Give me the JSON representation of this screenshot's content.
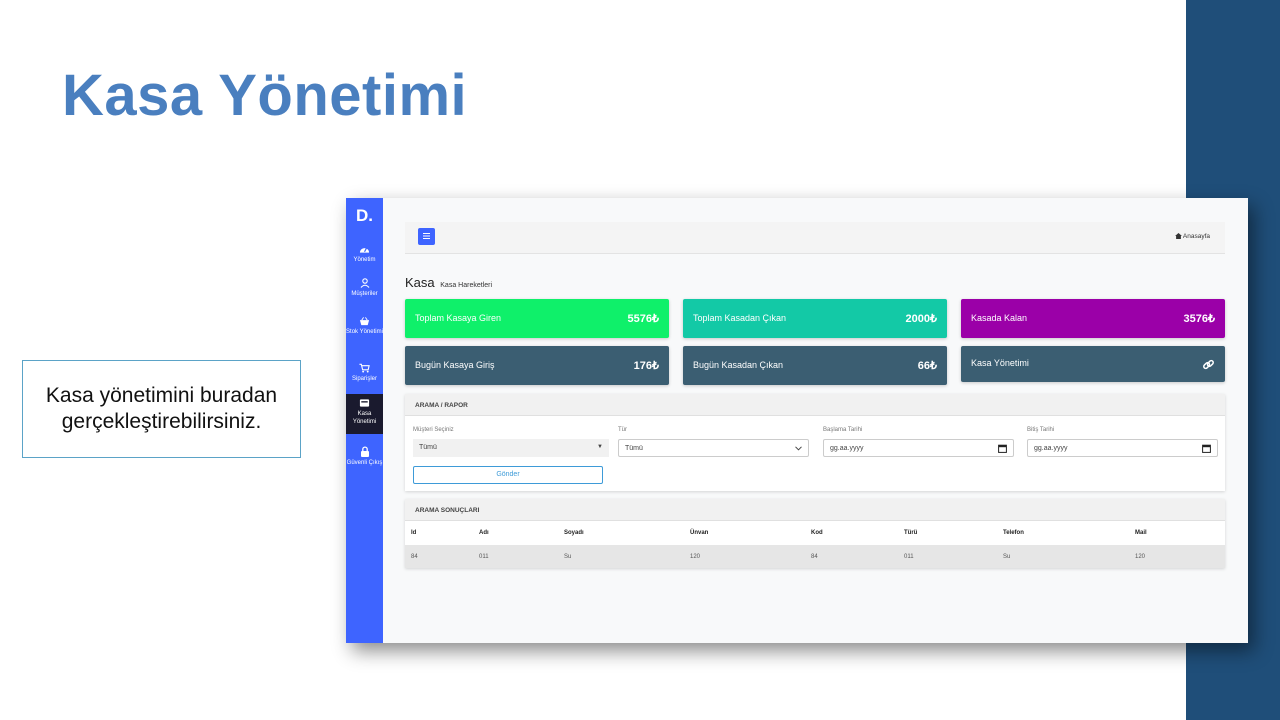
{
  "slide": {
    "title": "Kasa Yönetimi",
    "callout": "Kasa yönetimini buradan gerçekleştirebilirsiniz."
  },
  "colors": {
    "title": "#4a7fbf",
    "band": "#1f4e79",
    "sidebar": "#3e64ff",
    "green": "#0ff06a",
    "teal": "#13c9a6",
    "purple": "#9b00a8",
    "slate": "#3b5e72"
  },
  "app": {
    "logo": "D.",
    "nav": [
      {
        "label": "Yönetim",
        "icon": "dashboard-icon"
      },
      {
        "label": "Müşteriler",
        "icon": "user-icon"
      },
      {
        "label": "Stok Yönetimi",
        "icon": "basket-icon"
      },
      {
        "label": "Siparişler",
        "icon": "cart-icon"
      },
      {
        "label": "Kasa Yönetimi",
        "icon": "cash-register-icon"
      },
      {
        "label": "Güvenli Çıkış",
        "icon": "lock-icon"
      }
    ],
    "breadcrumb": "Anasayfa",
    "page_title": "Kasa",
    "page_subtitle": "Kasa Hareketleri",
    "cards": [
      {
        "label": "Toplam Kasaya Giren",
        "value": "5576₺"
      },
      {
        "label": "Toplam Kasadan Çıkan",
        "value": "2000₺"
      },
      {
        "label": "Kasada Kalan",
        "value": "3576₺"
      },
      {
        "label": "Bugün Kasaya Giriş",
        "value": "176₺"
      },
      {
        "label": "Bugün Kasadan Çıkan",
        "value": "66₺"
      },
      {
        "label": "Kasa Yönetimi",
        "icon": "link-icon"
      }
    ],
    "search": {
      "title": "ARAMA / RAPOR",
      "customer_label": "Müşteri Seçiniz",
      "customer_value": "Tümü",
      "type_label": "Tür",
      "type_value": "Tümü",
      "start_label": "Başlama Tarihi",
      "start_placeholder": "gg.aa.yyyy",
      "end_label": "Bitiş Tarihi",
      "end_placeholder": "gg.aa.yyyy",
      "submit": "Gönder"
    },
    "results": {
      "title": "ARAMA SONUÇLARI",
      "columns": [
        "Id",
        "Adı",
        "Soyadı",
        "Ünvan",
        "Kod",
        "Türü",
        "Telefon",
        "Mail"
      ],
      "rows": [
        [
          "84",
          "011",
          "Su",
          "120",
          "84",
          "011",
          "Su",
          "120"
        ]
      ]
    }
  }
}
